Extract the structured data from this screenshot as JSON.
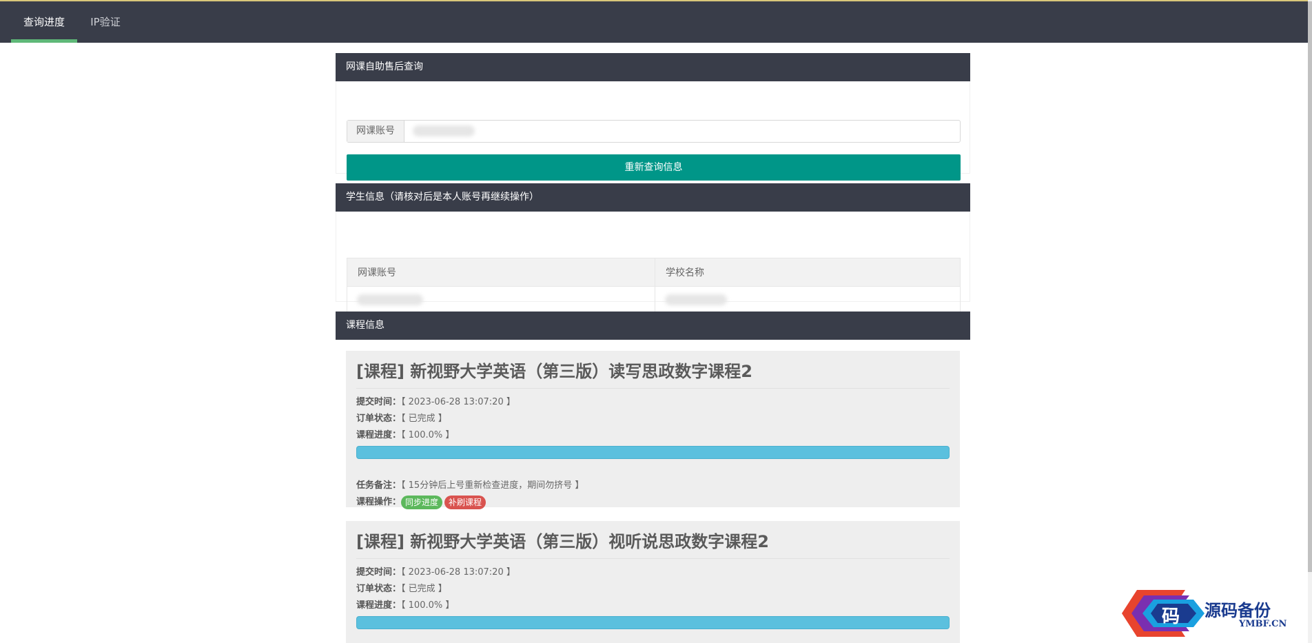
{
  "nav": {
    "tabs": [
      {
        "label": "查询进度"
      },
      {
        "label": "IP验证"
      }
    ]
  },
  "colors": {
    "header": "#393d49",
    "nav_active": "#5fb878",
    "primary_button": "#009688",
    "progress": "#5bc0de",
    "badge_green": "#5cb85c",
    "badge_red": "#d9534f"
  },
  "search": {
    "panel_title": "网课自助售后查询",
    "account_label": "网课账号",
    "account_value": "",
    "requery_button": "重新查询信息"
  },
  "student": {
    "panel_title": "学生信息（请核对后是本人账号再继续操作）",
    "columns": [
      "网课账号",
      "学校名称"
    ],
    "rows": [
      [
        "",
        ""
      ]
    ]
  },
  "courses": {
    "panel_title": "课程信息",
    "labels": {
      "submit_time": "提交时间：",
      "order_status": "订单状态：",
      "progress": "课程进度：",
      "task_note": "任务备注：",
      "operations": "课程操作："
    },
    "items": [
      {
        "title": "[课程] 新视野大学英语（第三版）读写思政数字课程2",
        "submit_time": "【 2023-06-28 13:07:20 】",
        "order_status": "【 已完成 】",
        "progress_text": "【 100.0% 】",
        "progress_value": 100,
        "task_note": "【 15分钟后上号重新检查进度，期间勿挤号 】",
        "sync_button": "同步进度",
        "redo_button": "补刷课程"
      },
      {
        "title": "[课程] 新视野大学英语（第三版）视听说思政数字课程2",
        "submit_time": "【 2023-06-28 13:07:20 】",
        "order_status": "【 已完成 】",
        "progress_text": "【 100.0% 】",
        "progress_value": 100
      }
    ]
  },
  "watermark": {
    "logo_char": "码",
    "title": "源码备份",
    "subtitle": "YMBF.CN"
  }
}
